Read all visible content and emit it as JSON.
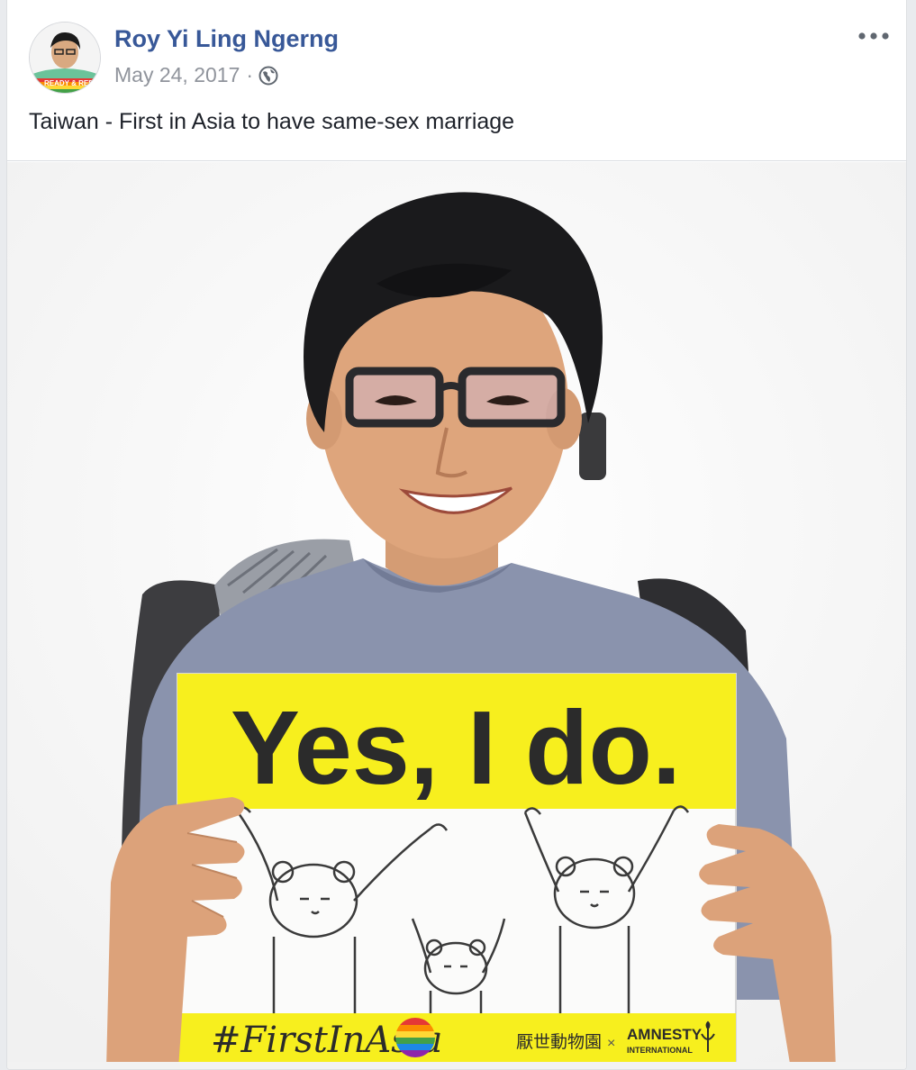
{
  "post": {
    "author": "Roy Yi Ling Ngerng",
    "date": "May 24, 2017",
    "separator": "·",
    "privacy_icon": "globe-icon",
    "more_icon": "ellipsis-icon",
    "text": "Taiwan - First in Asia to have same-sex marriage",
    "avatar_badge": "READY & REPEAL"
  },
  "photo": {
    "sign_headline": "Yes, I do.",
    "hashtag": "#FirstInAsia",
    "partner_cn": "厭世動物園",
    "partner_x": "×",
    "amnesty_top": "AMNESTY",
    "amnesty_bottom": "INTERNATIONAL"
  },
  "colors": {
    "link": "#385898",
    "meta": "#90949c",
    "text": "#1d2129",
    "sign_yellow": "#f7ef1e",
    "shirt": "#8a93ad",
    "hair": "#1a1a1c"
  }
}
